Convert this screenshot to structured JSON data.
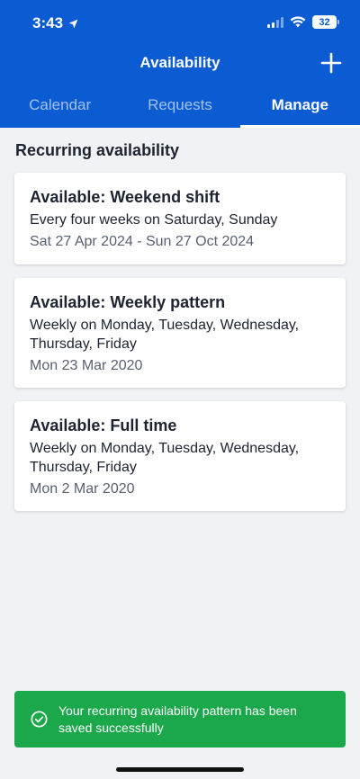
{
  "status_bar": {
    "time": "3:43",
    "battery": "32",
    "icons": [
      "location-arrow-icon",
      "cellular-signal-icon",
      "wifi-icon",
      "battery-icon"
    ]
  },
  "header": {
    "title": "Availability",
    "add_icon": "plus-icon",
    "background_color": "#0b5bd3"
  },
  "tabs": [
    {
      "label": "Calendar",
      "active": false
    },
    {
      "label": "Requests",
      "active": false
    },
    {
      "label": "Manage",
      "active": true
    }
  ],
  "main": {
    "section_title": "Recurring availability",
    "cards": [
      {
        "title": "Available: Weekend shift",
        "description": "Every four weeks on Saturday, Sunday",
        "date": "Sat 27 Apr 2024 - Sun 27 Oct 2024"
      },
      {
        "title": "Available: Weekly pattern",
        "description": "Weekly on Monday, Tuesday, Wednesday, Thursday, Friday",
        "date": "Mon 23 Mar 2020"
      },
      {
        "title": "Available: Full time",
        "description": "Weekly on Monday, Tuesday, Wednesday, Thursday, Friday",
        "date": "Mon 2 Mar 2020"
      }
    ]
  },
  "toast": {
    "icon": "check-circle-icon",
    "message": "Your recurring availability pattern has been saved successfully",
    "color": "#1ba84a"
  }
}
